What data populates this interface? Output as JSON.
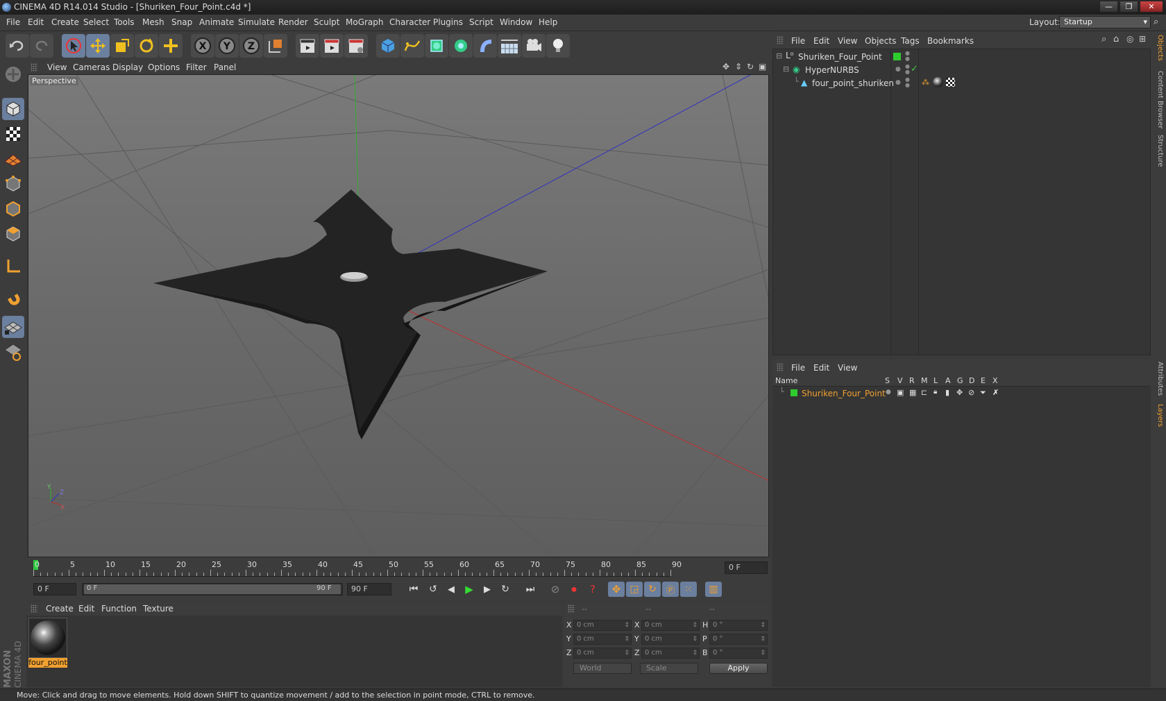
{
  "window": {
    "title": "CINEMA 4D R14.014 Studio - [Shuriken_Four_Point.c4d *]",
    "minimize": "—",
    "restore": "❐",
    "close": "✕"
  },
  "menu": [
    "File",
    "Edit",
    "Create",
    "Select",
    "Tools",
    "Mesh",
    "Snap",
    "Animate",
    "Simulate",
    "Render",
    "Sculpt",
    "MoGraph",
    "Character",
    "Plugins",
    "Script",
    "Window",
    "Help"
  ],
  "layout": {
    "label": "Layout:",
    "value": "Startup"
  },
  "viewport": {
    "menu": [
      "View",
      "Cameras",
      "Display",
      "Options",
      "Filter",
      "Panel"
    ],
    "label": "Perspective",
    "axis_labels": {
      "x": "X",
      "y": "Y",
      "z": "Z"
    }
  },
  "timeline": {
    "ticks": [
      "0",
      "5",
      "10",
      "15",
      "20",
      "25",
      "30",
      "35",
      "40",
      "45",
      "50",
      "55",
      "60",
      "65",
      "70",
      "75",
      "80",
      "85",
      "90"
    ],
    "current_frame": "0 F",
    "start_field": "0 F",
    "range_start": "0 F",
    "range_end": "90 F",
    "end_field": "90 F"
  },
  "materials": {
    "menu": [
      "Create",
      "Edit",
      "Function",
      "Texture"
    ],
    "items": [
      {
        "name": "four_point"
      }
    ]
  },
  "coordinates": {
    "headers": [
      "--",
      "--",
      "--"
    ],
    "rows": [
      {
        "pos_label": "X",
        "pos": "0 cm",
        "size_label": "X",
        "size": "0 cm",
        "rot_label": "H",
        "rot": "0 °"
      },
      {
        "pos_label": "Y",
        "pos": "0 cm",
        "size_label": "Y",
        "size": "0 cm",
        "rot_label": "P",
        "rot": "0 °"
      },
      {
        "pos_label": "Z",
        "pos": "0 cm",
        "size_label": "Z",
        "size": "0 cm",
        "rot_label": "B",
        "rot": "0 °"
      }
    ],
    "space": "World",
    "mode": "Scale",
    "apply": "Apply"
  },
  "objects": {
    "menu": [
      "File",
      "Edit",
      "View",
      "Objects",
      "Tags",
      "Bookmarks"
    ],
    "items": [
      {
        "name": "Shuriken_Four_Point"
      },
      {
        "name": "HyperNURBS"
      },
      {
        "name": "four_point_shuriken"
      }
    ]
  },
  "layers": {
    "menu": [
      "File",
      "Edit",
      "View"
    ],
    "columns": [
      "Name",
      "S",
      "V",
      "R",
      "M",
      "L",
      "A",
      "G",
      "D",
      "E",
      "X"
    ],
    "items": [
      {
        "name": "Shuriken_Four_Point",
        "color": "#2ecc2e"
      }
    ]
  },
  "right_tabs": [
    "Objects",
    "Content Browser",
    "Structure",
    "Attributes",
    "Layers"
  ],
  "status": "Move: Click and drag to move elements. Hold down SHIFT to quantize movement / add to the selection in point mode, CTRL to remove.",
  "branding": {
    "maxon": "MAXON",
    "product": "CINEMA 4D"
  },
  "colors": {
    "accent": "#6b7f9e",
    "selected_text": "#f0a030",
    "x_axis": "#c03030",
    "y_axis": "#30b030",
    "z_axis": "#3030c0"
  }
}
